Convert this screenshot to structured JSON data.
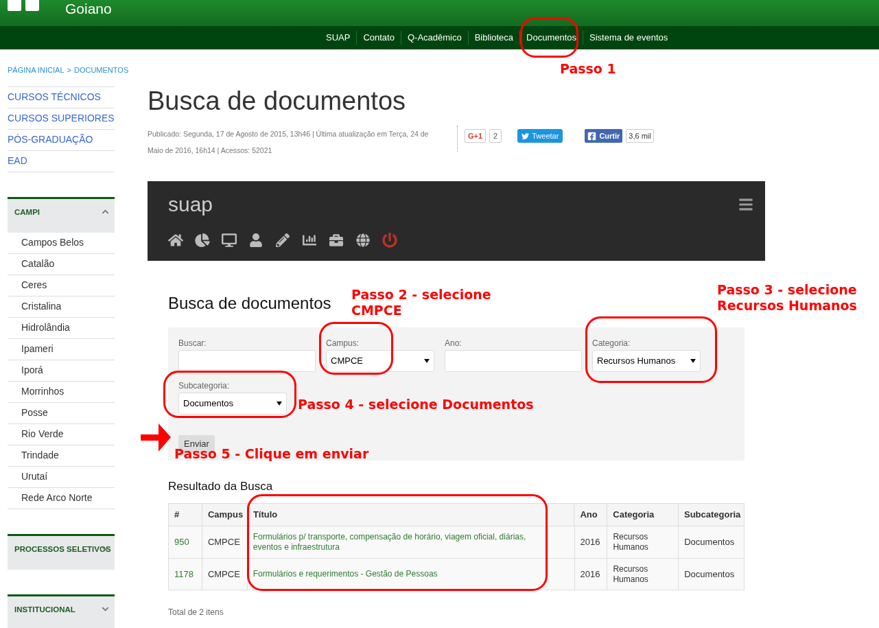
{
  "header": {
    "site_name": "Goiano"
  },
  "nav": {
    "items": [
      {
        "label": "SUAP"
      },
      {
        "label": "Contato"
      },
      {
        "label": "Q-Acadêmico"
      },
      {
        "label": "Biblioteca"
      },
      {
        "label": "Documentos"
      },
      {
        "label": "Sistema de eventos"
      }
    ]
  },
  "breadcrumb": [
    "PÁGINA INICIAL",
    ">",
    "DOCUMENTOS"
  ],
  "sidebar": {
    "links": [
      "CURSOS TÉCNICOS",
      "CURSOS SUPERIORES",
      "PÓS-GRADUAÇÃO",
      "EAD"
    ],
    "sections": [
      {
        "title": "CAMPI",
        "expanded": true,
        "children": [
          "Campos Belos",
          "Catalão",
          "Ceres",
          "Cristalina",
          "Hidrolândia",
          "Ipameri",
          "Iporá",
          "Morrinhos",
          "Posse",
          "Rio Verde",
          "Trindade",
          "Urutaí",
          "Rede Arco Norte"
        ]
      },
      {
        "title": "PROCESSOS SELETIVOS",
        "expanded": false
      },
      {
        "title": "INSTITUCIONAL",
        "expanded": false
      }
    ]
  },
  "article": {
    "title": "Busca de documentos",
    "meta": "Publicado: Segunda, 17 de Agosto de 2015, 13h46 | Última atualização em Terça, 24 de Maio de 2016, 16h14 | Acessos: 52021",
    "social": {
      "gplus": "G+1",
      "gplus_count": "2",
      "tweet": "Tweetar",
      "like": "Curtir",
      "like_count": "3,6 mil"
    }
  },
  "suap": {
    "logo": "suap"
  },
  "form": {
    "title": "Busca de documentos",
    "fields": [
      {
        "label": "Buscar:",
        "kind": "text"
      },
      {
        "label": "Campus:",
        "kind": "select",
        "value": "CMPCE"
      },
      {
        "label": "Ano:",
        "kind": "text"
      },
      {
        "label": "Categoria:",
        "kind": "select",
        "value": "Recursos Humanos"
      },
      {
        "label": "Subcategoria:",
        "kind": "select",
        "value": "Documentos"
      }
    ],
    "submit": "Enviar"
  },
  "results": {
    "title": "Resultado da Busca",
    "columns": [
      "#",
      "Campus",
      "Título",
      "Ano",
      "Categoria",
      "Subcategoria"
    ],
    "rows": [
      [
        "950",
        "CMPCE",
        "Formulários p/ transporte, compensação de horário, viagem oficial, diárias, eventos e infraestrutura",
        "2016",
        "Recursos Humanos",
        "Documentos"
      ],
      [
        "1178",
        "CMPCE",
        "Formulários e requerimentos - Gestão de Pessoas",
        "2016",
        "Recursos Humanos",
        "Documentos"
      ]
    ],
    "total": "Total de 2 itens"
  },
  "annotations": [
    {
      "text": "Passo 1"
    },
    {
      "text": "Passo 2 - selecione CMPCE"
    },
    {
      "text": "Passo 3 - selecione Recursos Humanos"
    },
    {
      "text": "Passo 4 - selecione Documentos"
    },
    {
      "text": "Passo 5 - Clique em enviar"
    }
  ]
}
